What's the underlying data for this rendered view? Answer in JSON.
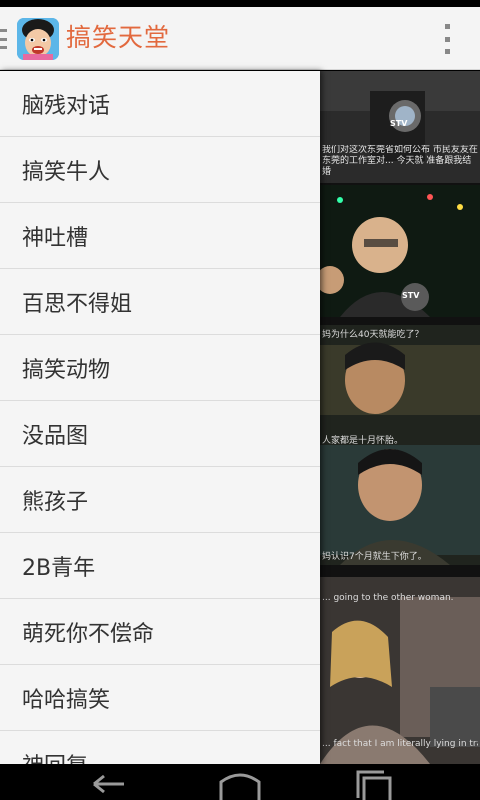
{
  "app": {
    "title": "搞笑天堂",
    "icon": "cartoon-face-icon",
    "accent_color": "#e2693e"
  },
  "drawer": {
    "items": [
      {
        "label": "脑残对话"
      },
      {
        "label": "搞笑牛人"
      },
      {
        "label": "神吐槽"
      },
      {
        "label": "百思不得姐"
      },
      {
        "label": "搞笑动物"
      },
      {
        "label": "没品图"
      },
      {
        "label": "熊孩子"
      },
      {
        "label": "2B青年"
      },
      {
        "label": "萌死你不偿命"
      },
      {
        "label": "哈哈搞笑"
      },
      {
        "label": "神回复"
      }
    ]
  },
  "feed": {
    "panel1_caption": "我们对这次东莞省如何公布 市民友友在东莞的工作室对... 今天就 准备跟我结婚",
    "panel1_logo": "STV",
    "panel2_logo": "STV",
    "panel3_caption_top": "妈为什么40天就能吃了？",
    "panel3_caption_bottom": "人家都是十月怀胎。",
    "panel4_caption": "妈认识7个月就生下你了。",
    "panel5_caption_top": "... going to the other woman.",
    "panel5_caption_bottom": "... fact that I am literally lying in trash."
  },
  "navbar": {
    "back": "back-icon",
    "home": "home-icon",
    "recents": "recent-apps-icon"
  }
}
